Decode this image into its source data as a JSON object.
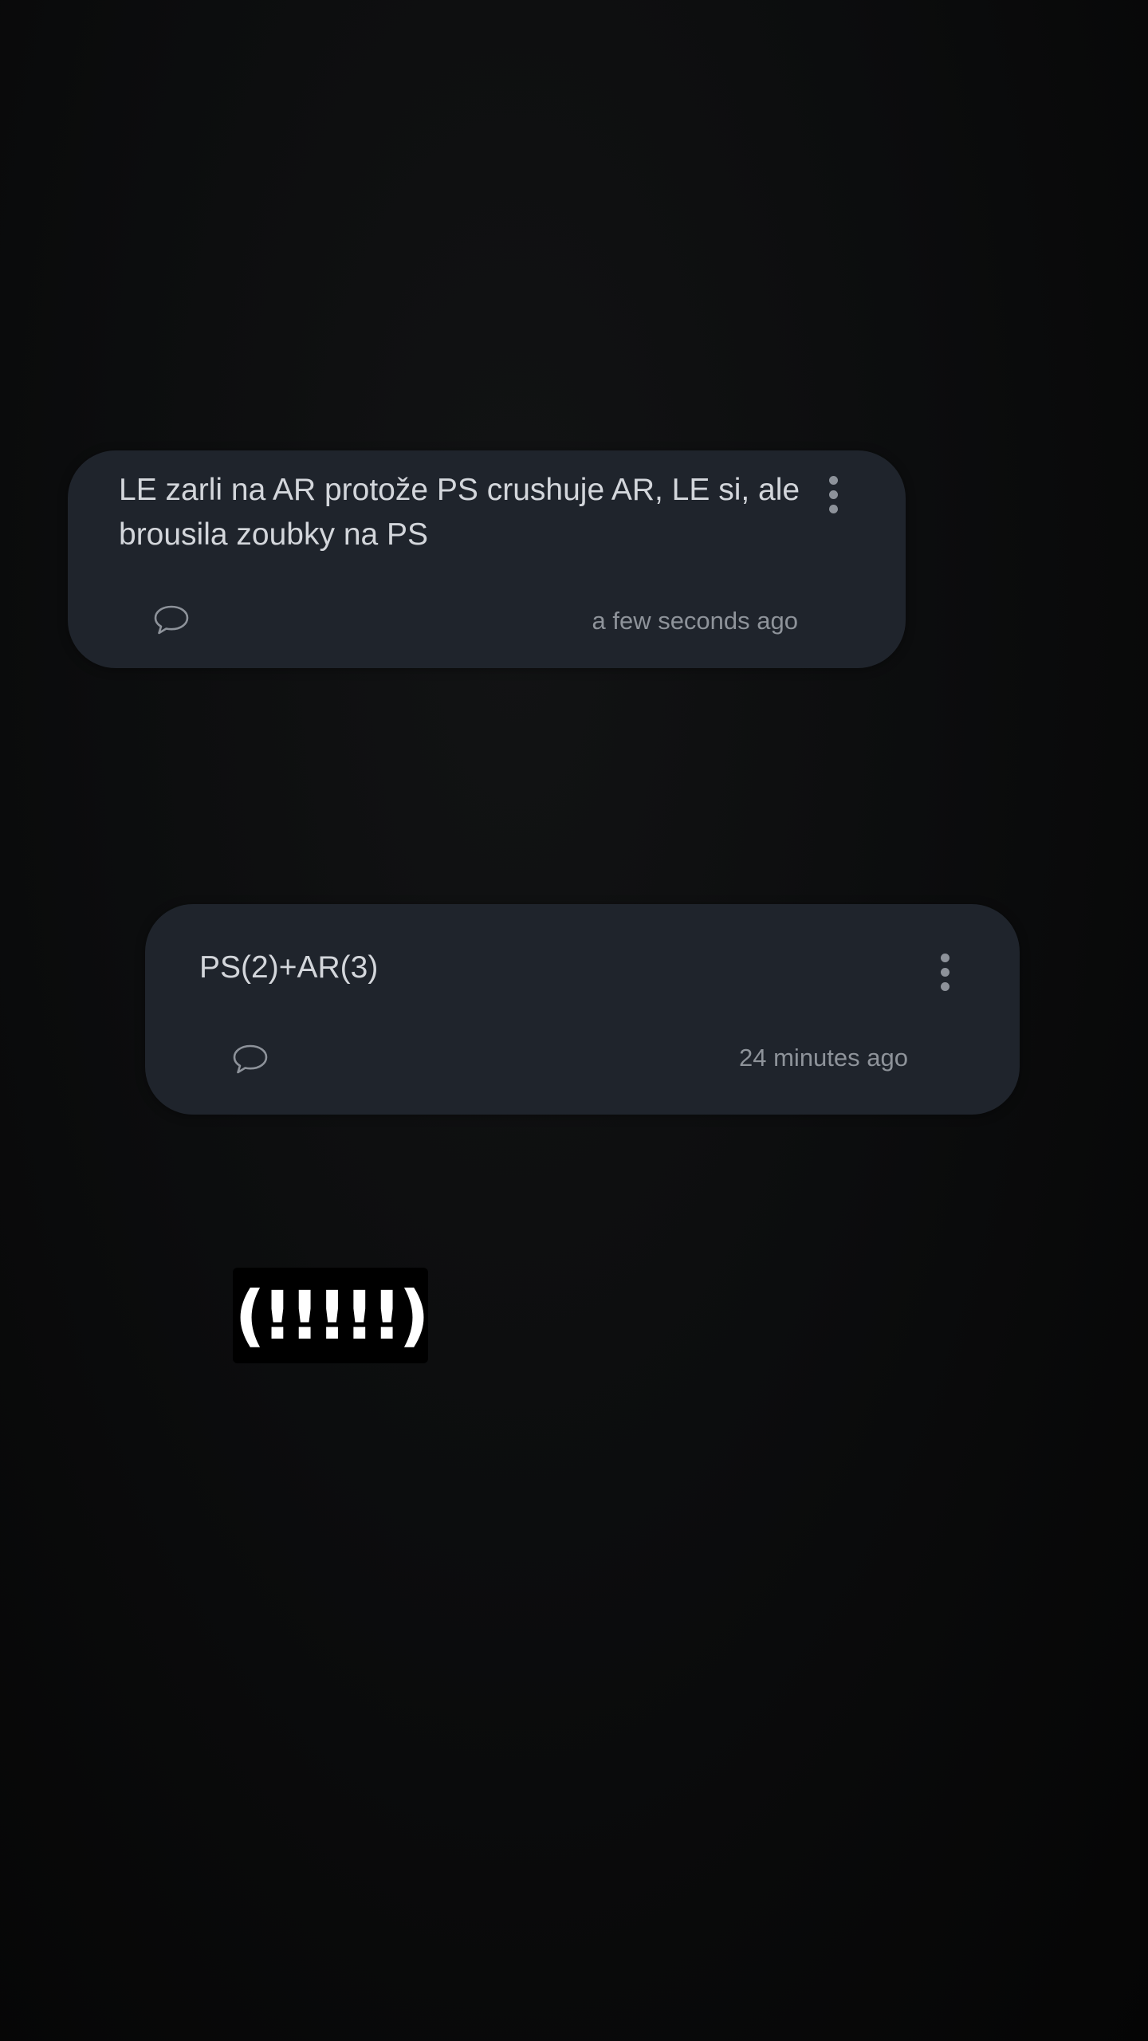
{
  "notes": [
    {
      "text": "LE zarli na AR protože PS crushuje AR, LE si, ale brousila zoubky na PS",
      "timestamp": "a few seconds ago",
      "comment_icon": "speech-bubble-icon",
      "menu_icon": "more-vert-icon"
    },
    {
      "text": "PS(2)+AR(3)",
      "timestamp": "24 minutes ago",
      "comment_icon": "speech-bubble-icon",
      "menu_icon": "more-vert-icon"
    }
  ],
  "overlay": {
    "text": "(!!!!!)"
  },
  "colors": {
    "background": "#0c0d0e",
    "card": "#1f242c",
    "text": "#d3d6db",
    "muted": "#8e939a"
  }
}
